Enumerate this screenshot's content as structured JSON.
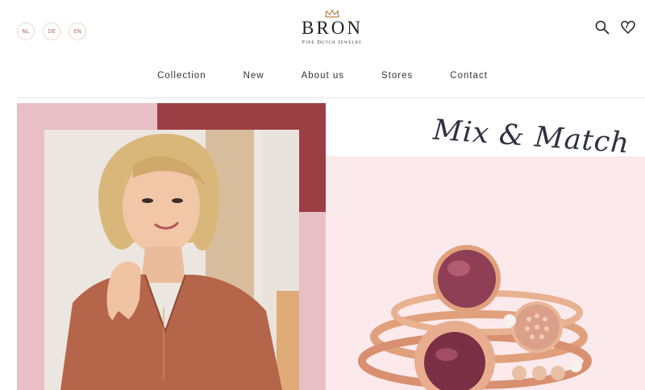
{
  "languages": [
    "NL",
    "DE",
    "EN"
  ],
  "brand": {
    "name": "BRON",
    "tagline": "Fine Dutch Jewelry"
  },
  "header_icons": [
    "search-icon",
    "heart-icon"
  ],
  "nav": {
    "items": [
      "Collection",
      "New",
      "About us",
      "Stores",
      "Contact"
    ]
  },
  "hero": {
    "heading": "Mix & Match"
  },
  "colors": {
    "accent_pink": "#e7bfc4",
    "accent_burgundy": "#9c3f45",
    "light_pink": "#fce9ec",
    "rose_gold": "#e0a07c"
  }
}
